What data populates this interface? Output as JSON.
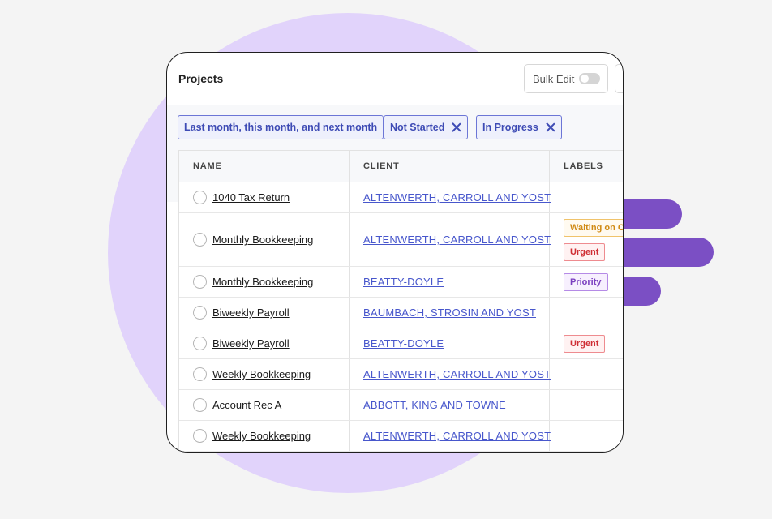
{
  "header": {
    "title": "Projects",
    "bulk_edit_label": "Bulk Edit",
    "bulk_edit_on": false
  },
  "filters": [
    {
      "label": "Last month, this month, and next month",
      "removable": false
    },
    {
      "label": "Not Started",
      "removable": true
    },
    {
      "label": "In Progress",
      "removable": true
    }
  ],
  "table": {
    "columns": {
      "name": "NAME",
      "client": "CLIENT",
      "labels": "LABELS"
    },
    "rows": [
      {
        "name": "1040 Tax Return",
        "client": "ALTENWERTH, CARROLL AND YOST",
        "labels": []
      },
      {
        "name": "Monthly Bookkeeping",
        "client": "ALTENWERTH, CARROLL AND YOST",
        "labels": [
          {
            "text": "Waiting on Cl",
            "kind": "waiting"
          },
          {
            "text": "Urgent",
            "kind": "urgent"
          }
        ]
      },
      {
        "name": "Monthly Bookkeeping",
        "client": "BEATTY-DOYLE",
        "labels": [
          {
            "text": "Priority",
            "kind": "priority"
          }
        ]
      },
      {
        "name": "Biweekly Payroll",
        "client": "BAUMBACH, STROSIN AND YOST",
        "labels": []
      },
      {
        "name": "Biweekly Payroll",
        "client": "BEATTY-DOYLE",
        "labels": [
          {
            "text": "Urgent",
            "kind": "urgent"
          }
        ]
      },
      {
        "name": "Weekly Bookkeeping",
        "client": "ALTENWERTH, CARROLL AND YOST",
        "labels": []
      },
      {
        "name": "Account Rec A",
        "client": "ABBOTT, KING AND TOWNE",
        "labels": []
      },
      {
        "name": "Weekly Bookkeeping",
        "client": "ALTENWERTH, CARROLL AND YOST",
        "labels": []
      }
    ]
  },
  "colors": {
    "accent": "#4857cc",
    "background_circle": "#e1d3fb",
    "decor_bars": "#7b4fc4"
  }
}
